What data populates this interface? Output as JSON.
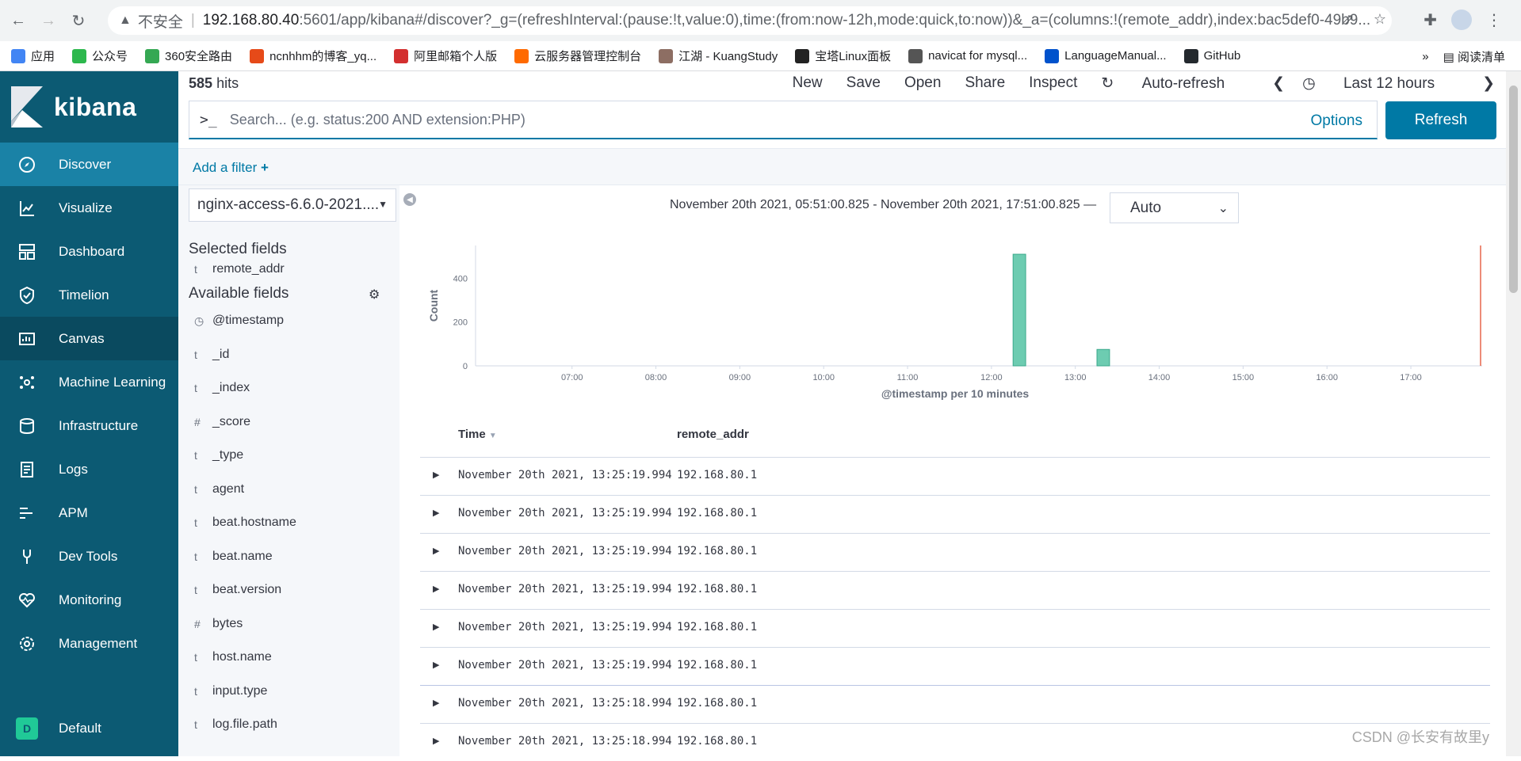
{
  "browser": {
    "insecure_label": "不安全",
    "url_host": "192.168.80.40",
    "url_path": ":5601/app/kibana#/discover?_g=(refreshInterval:(pause:!t,value:0),time:(from:now-12h,mode:quick,to:now))&_a=(columns:!(remote_addr),index:bac5def0-49b9...",
    "bookmarks": [
      {
        "label": "应用",
        "color": "#4285f4"
      },
      {
        "label": "公众号",
        "color": "#2db84d"
      },
      {
        "label": "360安全路由",
        "color": "#35a853"
      },
      {
        "label": "ncnhhm的博客_yq...",
        "color": "#e64a19"
      },
      {
        "label": "阿里邮箱个人版",
        "color": "#d32f2f"
      },
      {
        "label": "云服务器管理控制台",
        "color": "#ff6a00"
      },
      {
        "label": "江湖 - KuangStudy",
        "color": "#8d6e63"
      },
      {
        "label": "宝塔Linux面板",
        "color": "#222222"
      },
      {
        "label": "navicat for mysql...",
        "color": "#555555"
      },
      {
        "label": "LanguageManual...",
        "color": "#0052cc"
      },
      {
        "label": "GitHub",
        "color": "#24292e"
      }
    ],
    "bookmarks_more": "»",
    "reading_list": "阅读清单"
  },
  "sidebar": {
    "logo_text": "kibana",
    "items": [
      {
        "label": "Discover",
        "icon": "compass-icon"
      },
      {
        "label": "Visualize",
        "icon": "chart-icon"
      },
      {
        "label": "Dashboard",
        "icon": "dashboard-icon"
      },
      {
        "label": "Timelion",
        "icon": "shield-icon"
      },
      {
        "label": "Canvas",
        "icon": "canvas-icon"
      },
      {
        "label": "Machine Learning",
        "icon": "ml-icon"
      },
      {
        "label": "Infrastructure",
        "icon": "infrastructure-icon"
      },
      {
        "label": "Logs",
        "icon": "logs-icon"
      },
      {
        "label": "APM",
        "icon": "apm-icon"
      },
      {
        "label": "Dev Tools",
        "icon": "wrench-icon"
      },
      {
        "label": "Monitoring",
        "icon": "heart-monitor-icon"
      },
      {
        "label": "Management",
        "icon": "gear-icon"
      }
    ],
    "space_letter": "D",
    "space_label": "Default"
  },
  "topbar": {
    "hits_count": "585",
    "hits_label": "hits",
    "menu": [
      "New",
      "Save",
      "Open",
      "Share",
      "Inspect"
    ],
    "auto_refresh": "Auto-refresh",
    "time_label": "Last 12 hours"
  },
  "query": {
    "prompt": ">_",
    "placeholder": "Search... (e.g. status:200 AND extension:PHP)",
    "options": "Options",
    "refresh": "Refresh"
  },
  "filter": {
    "add_filter": "Add a filter"
  },
  "fields": {
    "index_pattern": "nginx-access-6.6.0-2021....",
    "selected_title": "Selected fields",
    "selected": [
      {
        "type": "t",
        "name": "remote_addr"
      }
    ],
    "available_title": "Available fields",
    "available": [
      {
        "type": "◷",
        "name": "@timestamp"
      },
      {
        "type": "t",
        "name": "_id"
      },
      {
        "type": "t",
        "name": "_index"
      },
      {
        "type": "#",
        "name": "_score"
      },
      {
        "type": "t",
        "name": "_type"
      },
      {
        "type": "t",
        "name": "agent"
      },
      {
        "type": "t",
        "name": "beat.hostname"
      },
      {
        "type": "t",
        "name": "beat.name"
      },
      {
        "type": "t",
        "name": "beat.version"
      },
      {
        "type": "#",
        "name": "bytes"
      },
      {
        "type": "t",
        "name": "host.name"
      },
      {
        "type": "t",
        "name": "input.type"
      },
      {
        "type": "t",
        "name": "log.file.path"
      }
    ]
  },
  "histogram": {
    "time_range": "November 20th 2021, 05:51:00.825 - November 20th 2021, 17:51:00.825 —",
    "interval": "Auto"
  },
  "chart_data": {
    "type": "bar",
    "x_ticks": [
      "07:00",
      "08:00",
      "09:00",
      "10:00",
      "11:00",
      "12:00",
      "13:00",
      "14:00",
      "15:00",
      "16:00",
      "17:00"
    ],
    "x_range_hours": [
      5.85,
      17.85
    ],
    "bars": [
      {
        "x": "12:20",
        "x_hours": 12.333,
        "value": 510
      },
      {
        "x": "13:20",
        "x_hours": 13.333,
        "value": 75
      }
    ],
    "y_ticks": [
      0,
      200,
      400
    ],
    "ylim": [
      0,
      550
    ],
    "xlabel": "@timestamp per 10 minutes",
    "ylabel": "Count",
    "bar_color": "#6dccb1"
  },
  "table": {
    "col_time": "Time",
    "col_addr": "remote_addr",
    "rows": [
      {
        "time": "November 20th 2021, 13:25:19.994",
        "addr": "192.168.80.1"
      },
      {
        "time": "November 20th 2021, 13:25:19.994",
        "addr": "192.168.80.1"
      },
      {
        "time": "November 20th 2021, 13:25:19.994",
        "addr": "192.168.80.1"
      },
      {
        "time": "November 20th 2021, 13:25:19.994",
        "addr": "192.168.80.1"
      },
      {
        "time": "November 20th 2021, 13:25:19.994",
        "addr": "192.168.80.1"
      },
      {
        "time": "November 20th 2021, 13:25:19.994",
        "addr": "192.168.80.1"
      },
      {
        "time": "November 20th 2021, 13:25:18.994",
        "addr": "192.168.80.1"
      },
      {
        "time": "November 20th 2021, 13:25:18.994",
        "addr": "192.168.80.1"
      }
    ]
  },
  "watermark": "CSDN @长安有故里y"
}
